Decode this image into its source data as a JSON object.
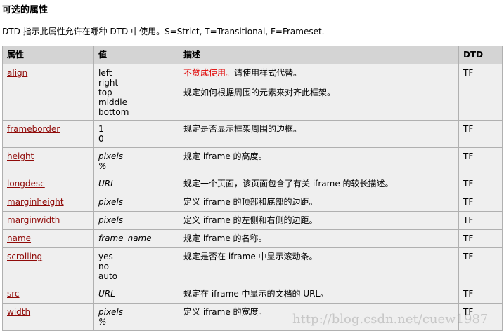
{
  "title": "可选的属性",
  "intro": "DTD 指示此属性允许在哪种 DTD 中使用。S=Strict, T=Transitional, F=Frameset.",
  "headers": [
    "属性",
    "值",
    "描述",
    "DTD"
  ],
  "rows": [
    {
      "attr": "align",
      "values": [
        "left",
        "right",
        "top",
        "middle",
        "bottom"
      ],
      "italic": false,
      "deprecated": "不赞成使用。",
      "desc": "请使用样式代替。",
      "desc2": "规定如何根据周围的元素来对齐此框架。",
      "dtd": "TF"
    },
    {
      "attr": "frameborder",
      "values": [
        "1",
        "0"
      ],
      "italic": false,
      "desc": "规定是否显示框架周围的边框。",
      "dtd": "TF"
    },
    {
      "attr": "height",
      "values": [
        "pixels",
        "%"
      ],
      "italic": true,
      "desc": "规定 iframe 的高度。",
      "dtd": "TF"
    },
    {
      "attr": "longdesc",
      "values": [
        "URL"
      ],
      "italic": true,
      "desc": "规定一个页面，该页面包含了有关 iframe 的较长描述。",
      "dtd": "TF"
    },
    {
      "attr": "marginheight",
      "values": [
        "pixels"
      ],
      "italic": true,
      "desc": "定义 iframe 的顶部和底部的边距。",
      "dtd": "TF"
    },
    {
      "attr": "marginwidth",
      "values": [
        "pixels"
      ],
      "italic": true,
      "desc": "定义 iframe 的左侧和右侧的边距。",
      "dtd": "TF"
    },
    {
      "attr": "name",
      "values": [
        "frame_name"
      ],
      "italic": true,
      "desc": "规定 iframe 的名称。",
      "dtd": "TF"
    },
    {
      "attr": "scrolling",
      "values": [
        "yes",
        "no",
        "auto"
      ],
      "italic": false,
      "desc": "规定是否在 iframe 中显示滚动条。",
      "dtd": "TF"
    },
    {
      "attr": "src",
      "values": [
        "URL"
      ],
      "italic": true,
      "desc": "规定在 iframe 中显示的文档的 URL。",
      "dtd": "TF"
    },
    {
      "attr": "width",
      "values": [
        "pixels",
        "%"
      ],
      "italic": true,
      "desc": "定义 iframe 的宽度。",
      "dtd": "TF"
    }
  ],
  "watermark": "http://blog.csdn.net/cuew1987"
}
